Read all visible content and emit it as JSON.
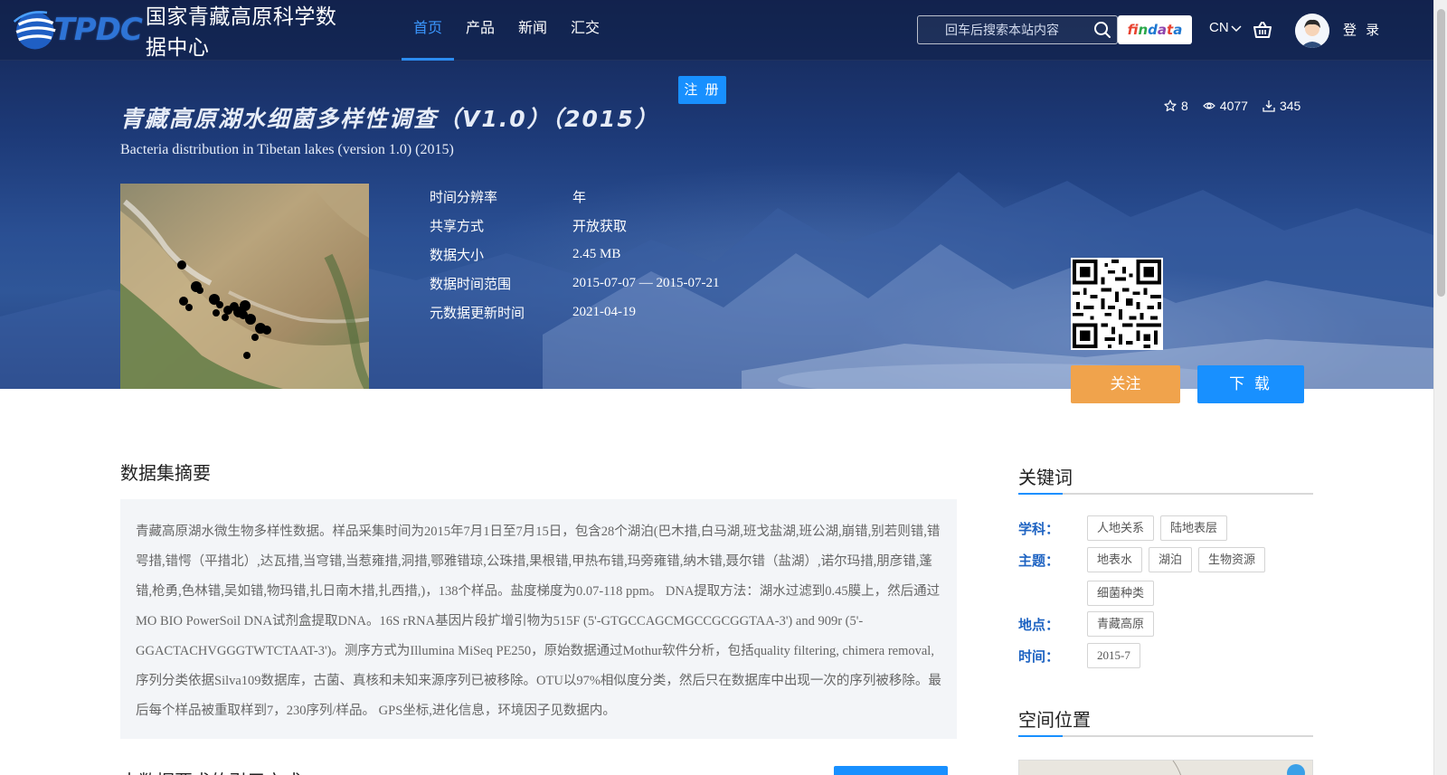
{
  "header": {
    "logo_text": "TPDC",
    "site_name": "国家青藏高原科学数据中心",
    "menu": [
      {
        "label": "首页",
        "active": true
      },
      {
        "label": "产品",
        "active": false
      },
      {
        "label": "新闻",
        "active": false
      },
      {
        "label": "汇交",
        "active": false
      }
    ],
    "search_placeholder": "回车后搜索本站内容",
    "findata_label": "findata",
    "language": "CN",
    "login_label": "登 录",
    "register_label": "注 册"
  },
  "dataset": {
    "title_cn": "青藏高原湖水细菌多样性调查（V1.0）（2015）",
    "title_en": "Bacteria distribution in Tibetan lakes (version 1.0) (2015)",
    "stats": {
      "favorites": "8",
      "views": "4077",
      "downloads": "345"
    },
    "meta": [
      {
        "key": "时间分辨率",
        "value": "年"
      },
      {
        "key": "共享方式",
        "value": "开放获取"
      },
      {
        "key": "数据大小",
        "value": "2.45 MB"
      },
      {
        "key": "数据时间范围",
        "value": "2015-07-07 — 2015-07-21"
      },
      {
        "key": "元数据更新时间",
        "value": "2021-04-19"
      }
    ],
    "follow_label": "关注",
    "download_label": "下 载"
  },
  "summary": {
    "title": "数据集摘要",
    "text": "青藏高原湖水微生物多样性数据。样品采集时间为2015年7月1日至7月15日，包含28个湖泊(巴木措,白马湖,班戈盐湖,班公湖,崩错,别若则错,错咢措,错愕（平措北）,达瓦措,当穹错,当惹雍措,洞措,鄂雅错琼,公珠措,果根错,甲热布错,玛旁雍错,纳木错,聂尔错（盐湖）,诺尔玛措,朋彦错,蓬错,枪勇,色林错,吴如错,物玛错,扎日南木措,扎西措,)，138个样品。盐度梯度为0.07-118 ppm。 DNA提取方法：湖水过滤到0.45膜上，然后通过MO BIO PowerSoil DNA试剂盒提取DNA。16S rRNA基因片段扩增引物为515F (5'-GTGCCAGCMGCCGCGGTAA-3') and 909r (5'-GGACTACHVGGGTWTCTAAT-3')。测序方式为Illumina MiSeq PE250，原始数据通过Mothur软件分析，包括quality filtering, chimera removal, 序列分类依据Silva109数据库，古菌、真核和未知来源序列已被移除。OTU以97%相似度分类，然后只在数据库中出现一次的序列被移除。最后每个样品被重取样到7，230序列/样品。 GPS坐标,进化信息，环境因子见数据内。",
    "citation_title": "本数据要求的引用方式"
  },
  "keywords": {
    "title": "关键词",
    "groups": [
      {
        "label": "学科：",
        "tags": [
          "人地关系",
          "陆地表层"
        ]
      },
      {
        "label": "主题：",
        "tags": [
          "地表水",
          "湖泊",
          "生物资源",
          "细菌种类"
        ]
      },
      {
        "label": "地点：",
        "tags": [
          "青藏高原"
        ]
      },
      {
        "label": "时间：",
        "tags": [
          "2015-7"
        ]
      }
    ]
  },
  "spatial": {
    "title": "空间位置"
  }
}
